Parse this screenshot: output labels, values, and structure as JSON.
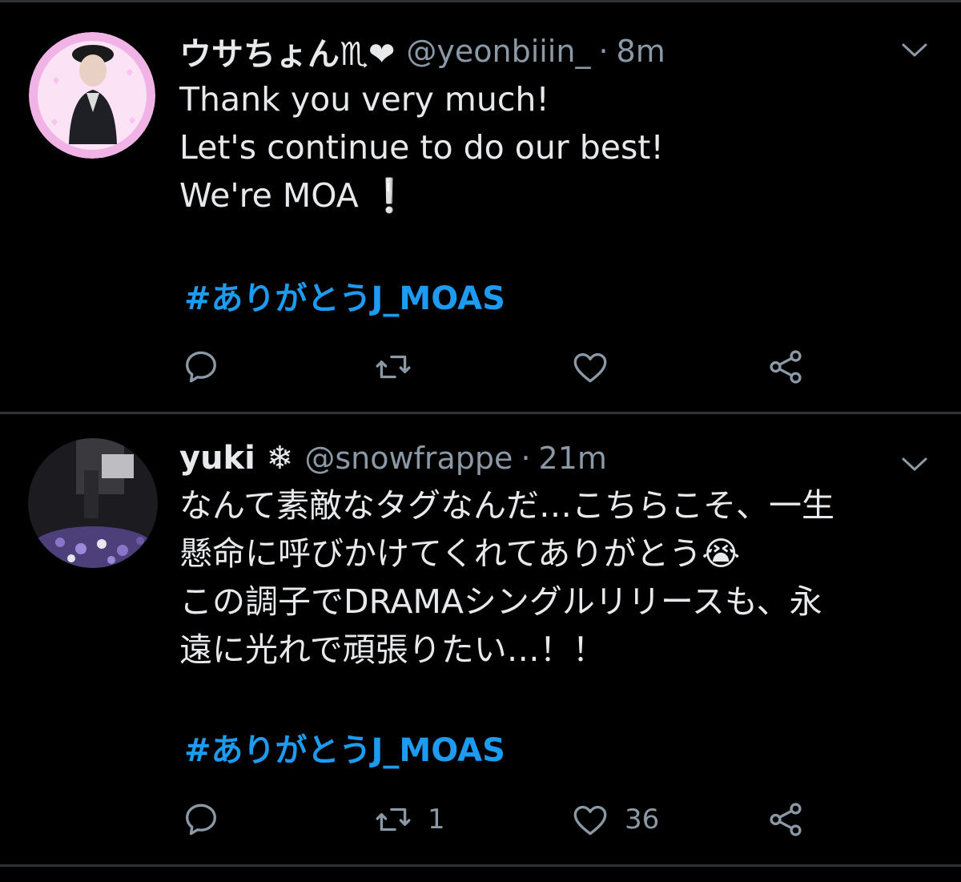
{
  "colors": {
    "background": "#000000",
    "divider": "#2f3336",
    "text_primary": "#e7e9ea",
    "text_secondary": "#8b98a5",
    "link": "#1d9bf0"
  },
  "tweets": [
    {
      "display_name": "ウサちょん♏︎❤",
      "handle": "@yeonbiiin_",
      "separator": "·",
      "time": "8m",
      "body": [
        "Thank you very much!",
        "Let's continue to do our best!",
        "We're MOA ❕"
      ],
      "hashtag": "#ありがとうJ_MOAS",
      "actions": {
        "reply_icon": "reply-icon",
        "retweet_icon": "retweet-icon",
        "retweet_count": "",
        "like_icon": "heart-icon",
        "like_count": "",
        "share_icon": "share-icon"
      }
    },
    {
      "display_name": "yuki ❄",
      "handle": "@snowfrappe",
      "separator": "·",
      "time": "21m",
      "body": [
        "なんて素敵なタグなんだ…こちらこそ、一生",
        "懸命に呼びかけてくれてありがとう😭",
        "この調子でDRAMAシングルリリースも、永",
        "遠に光れで頑張りたい…！！"
      ],
      "hashtag": "#ありがとうJ_MOAS",
      "actions": {
        "reply_icon": "reply-icon",
        "retweet_icon": "retweet-icon",
        "retweet_count": "1",
        "like_icon": "heart-icon",
        "like_count": "36",
        "share_icon": "share-icon"
      }
    }
  ]
}
